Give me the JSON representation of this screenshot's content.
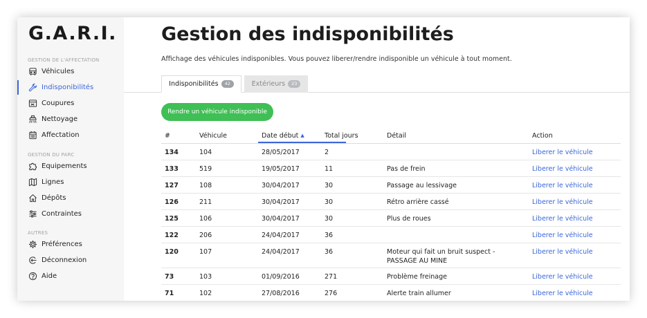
{
  "app": {
    "logo": "G.A.R.I."
  },
  "sidebar": {
    "sections": [
      {
        "title": "GESTION DE L'AFFECTATION"
      },
      {
        "title": "GESTION DU PARC"
      },
      {
        "title": "AUTRES"
      }
    ],
    "items": [
      {
        "label": "Véhicules",
        "icon": "vehicle-icon"
      },
      {
        "label": "Indisponibilités",
        "icon": "wrench-icon",
        "active": true
      },
      {
        "label": "Coupures",
        "icon": "cut-icon"
      },
      {
        "label": "Nettoyage",
        "icon": "cleaning-icon"
      },
      {
        "label": "Affectation",
        "icon": "calendar-icon"
      },
      {
        "label": "Equipements",
        "icon": "puzzle-icon"
      },
      {
        "label": "Lignes",
        "icon": "map-icon"
      },
      {
        "label": "Dépôts",
        "icon": "home-icon"
      },
      {
        "label": "Contraintes",
        "icon": "sliders-icon"
      },
      {
        "label": "Préférences",
        "icon": "gear-icon"
      },
      {
        "label": "Déconnexion",
        "icon": "logout-icon"
      },
      {
        "label": "Aide",
        "icon": "help-icon"
      }
    ]
  },
  "main": {
    "title": "Gestion des indisponibilités",
    "subtitle": "Affichage des véhicules indisponibles. Vous pouvez liberer/rendre indisponible un véhicule à tout moment.",
    "tabs": [
      {
        "label": "Indisponibilités",
        "count": "42"
      },
      {
        "label": "Extérieurs",
        "count": "23"
      }
    ],
    "primary_button": "Rendre un véhicule indisponible"
  },
  "table": {
    "columns": [
      "#",
      "Véhicule",
      "Date début",
      "Total jours",
      "Détail",
      "Action"
    ],
    "sort_indicator": "▲",
    "rows": [
      {
        "id": "134",
        "vehicle": "104",
        "date": "28/05/2017",
        "days": "2",
        "detail": "",
        "action": "Liberer le véhicule"
      },
      {
        "id": "133",
        "vehicle": "519",
        "date": "19/05/2017",
        "days": "11",
        "detail": "Pas de frein",
        "action": "Liberer le véhicule"
      },
      {
        "id": "127",
        "vehicle": "108",
        "date": "30/04/2017",
        "days": "30",
        "detail": "Passage au lessivage",
        "action": "Liberer le véhicule"
      },
      {
        "id": "126",
        "vehicle": "211",
        "date": "30/04/2017",
        "days": "30",
        "detail": "Rétro arrière cassé",
        "action": "Liberer le véhicule"
      },
      {
        "id": "125",
        "vehicle": "106",
        "date": "30/04/2017",
        "days": "30",
        "detail": "Plus de roues",
        "action": "Liberer le véhicule"
      },
      {
        "id": "122",
        "vehicle": "206",
        "date": "24/04/2017",
        "days": "36",
        "detail": "",
        "action": "Liberer le véhicule"
      },
      {
        "id": "120",
        "vehicle": "107",
        "date": "24/04/2017",
        "days": "36",
        "detail": "Moteur qui fait un bruit suspect - PASSAGE AU MINE",
        "action": "Liberer le véhicule"
      },
      {
        "id": "73",
        "vehicle": "103",
        "date": "01/09/2016",
        "days": "271",
        "detail": "Problème freinage",
        "action": "Liberer le véhicule"
      },
      {
        "id": "71",
        "vehicle": "102",
        "date": "27/08/2016",
        "days": "276",
        "detail": "Alerte train allumer",
        "action": "Liberer le véhicule"
      }
    ]
  },
  "colors": {
    "accent": "#3b66d8",
    "primary_button": "#3fbf55",
    "sidebar_bg": "#f6f6f6"
  }
}
